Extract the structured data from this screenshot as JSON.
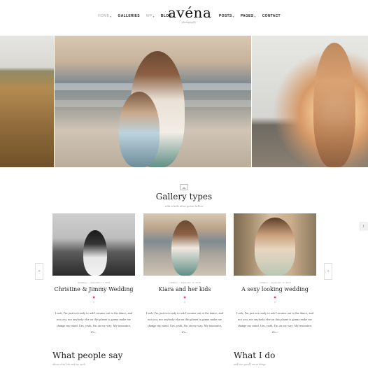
{
  "header": {
    "logo_name": "avéna",
    "logo_tagline": "photography",
    "nav_left": [
      {
        "label": "HOME",
        "caret": "▾",
        "active": true
      },
      {
        "label": "GALLERIES",
        "caret": "",
        "active": false
      },
      {
        "label": "WP",
        "caret": "▾",
        "active": false
      },
      {
        "label": "BLOG",
        "caret": "▾",
        "active": false
      }
    ],
    "nav_right": [
      {
        "label": "POSTS",
        "caret": "▾"
      },
      {
        "label": "PAGES",
        "caret": "▾"
      },
      {
        "label": "CONTACT",
        "caret": ""
      }
    ]
  },
  "section": {
    "icon": "image-icon",
    "title": "Gallery types",
    "subtitle": "with a little description bellow"
  },
  "carousel": {
    "prev_icon": "‹",
    "next_icon": "›",
    "scroll_top_icon": "↑",
    "cards": [
      {
        "category": "Weddings",
        "date": "September 17, 2018",
        "title": "Christine & Jimmy Wedding",
        "heart": "♥",
        "likes": "0",
        "text": "Look, I'm just not ready to ask Lorraine out to the dance, and not you, nor anybody else on this planet is gonna make me change my mind. Um, yeah, I'm on my way. My insurance, it's..."
      },
      {
        "category": "Children",
        "date": "September 17, 2018",
        "title": "Kiara and her kids",
        "heart": "♥",
        "likes": "0",
        "text": "Look, I'm just not ready to ask Lorraine out to the dance, and not you, nor anybody else on this planet is gonna make me change my mind. Um, yeah, I'm on my way. My insurance, it's..."
      },
      {
        "category": "Children",
        "date": "September 17, 2018",
        "title": "A sexy looking wedding",
        "heart": "♥",
        "likes": "0",
        "text": "Look, I'm just not ready to ask Lorraine out to the dance, and not you, nor anybody else on this planet is gonna make me change my mind. Um, yeah, I'm on my way. My insurance, it's..."
      }
    ]
  },
  "bottom": {
    "left_title": "What people say",
    "left_sub": "about what I do and my work",
    "right_title": "What I do",
    "right_sub": "and how good I am at things"
  },
  "colors": {
    "heart": "#e0204f",
    "text": "#222222",
    "muted": "#999999"
  }
}
